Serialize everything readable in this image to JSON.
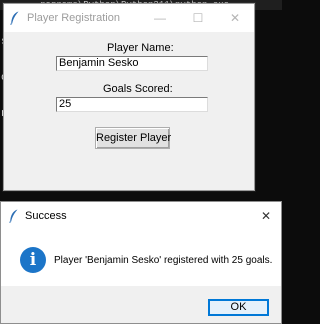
{
  "console": {
    "title_fragment": "rograms\\Python\\Python311\\python.exe",
    "lines": [
      "s",
      "o",
      "nj"
    ]
  },
  "registration_window": {
    "title": "Player Registration",
    "minimize_glyph": "—",
    "maximize_glyph": "☐",
    "close_glyph": "✕",
    "player_name_label": "Player Name:",
    "player_name_value": "Benjamin Sesko",
    "goals_label": "Goals Scored:",
    "goals_value": "25",
    "register_button_label": "Register Player"
  },
  "success_dialog": {
    "title": "Success",
    "close_glyph": "✕",
    "info_glyph": "i",
    "message": "Player 'Benjamin Sesko' registered with 25 goals.",
    "ok_label": "OK"
  },
  "colors": {
    "console_bg": "#0c0c0c",
    "window_bg": "#f0f0f0",
    "info_blue": "#1c75c8",
    "focus_blue": "#0078d7",
    "feather_icon": "#2d6fb5"
  },
  "icons": [
    "feather-icon",
    "minimize-icon",
    "maximize-icon",
    "close-icon",
    "info-icon"
  ]
}
